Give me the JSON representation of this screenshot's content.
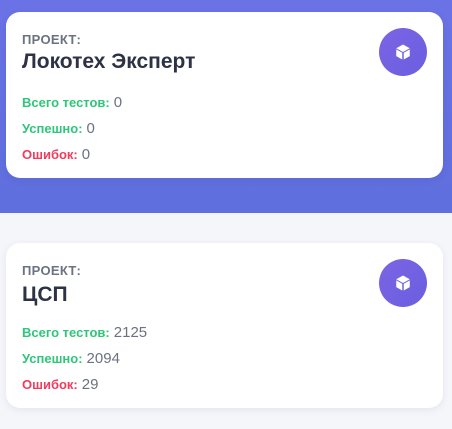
{
  "colors": {
    "band": "#6b72e6",
    "icon_bg": "#7b64e4",
    "success": "#2ec77a",
    "error": "#ef3c5d"
  },
  "projects": [
    {
      "label": "ПРОЕКТ:",
      "name": "Локотех Эксперт",
      "icon": "box-icon",
      "total_label": "Всего тестов:",
      "total": "0",
      "success_label": "Успешно:",
      "success": "0",
      "errors_label": "Ошибок:",
      "errors": "0"
    },
    {
      "label": "ПРОЕКТ:",
      "name": "ЦСП",
      "icon": "box-icon",
      "total_label": "Всего тестов:",
      "total": "2125",
      "success_label": "Успешно:",
      "success": "2094",
      "errors_label": "Ошибок:",
      "errors": "29"
    }
  ]
}
